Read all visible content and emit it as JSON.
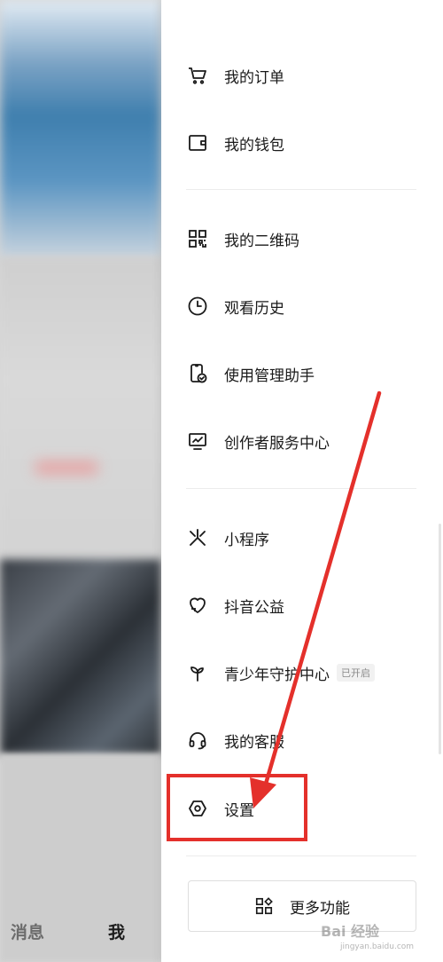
{
  "colors": {
    "accent": "#e4302b",
    "text": "#1a1a1a",
    "muted": "#8a8a8a"
  },
  "bottom_tabs": [
    {
      "label": "消息"
    },
    {
      "label": "我"
    }
  ],
  "menu": [
    {
      "label": "我的订单",
      "icon": "cart-icon"
    },
    {
      "label": "我的钱包",
      "icon": "wallet-icon"
    },
    {
      "label": "我的二维码",
      "icon": "qrcode-icon"
    },
    {
      "label": "观看历史",
      "icon": "clock-icon"
    },
    {
      "label": "使用管理助手",
      "icon": "phone-check-icon"
    },
    {
      "label": "创作者服务中心",
      "icon": "monitor-chart-icon"
    },
    {
      "label": "小程序",
      "icon": "mini-program-icon"
    },
    {
      "label": "抖音公益",
      "icon": "heart-hand-icon"
    },
    {
      "label": "青少年守护中心",
      "icon": "sprout-icon",
      "badge": "已开启"
    },
    {
      "label": "我的客服",
      "icon": "headset-icon"
    },
    {
      "label": "设置",
      "icon": "settings-hexagon-icon"
    }
  ],
  "more_button": {
    "label": "更多功能",
    "icon": "grid-icon"
  },
  "watermark": {
    "text": "Bai 经验",
    "sub": "jingyan.baidu.com"
  }
}
